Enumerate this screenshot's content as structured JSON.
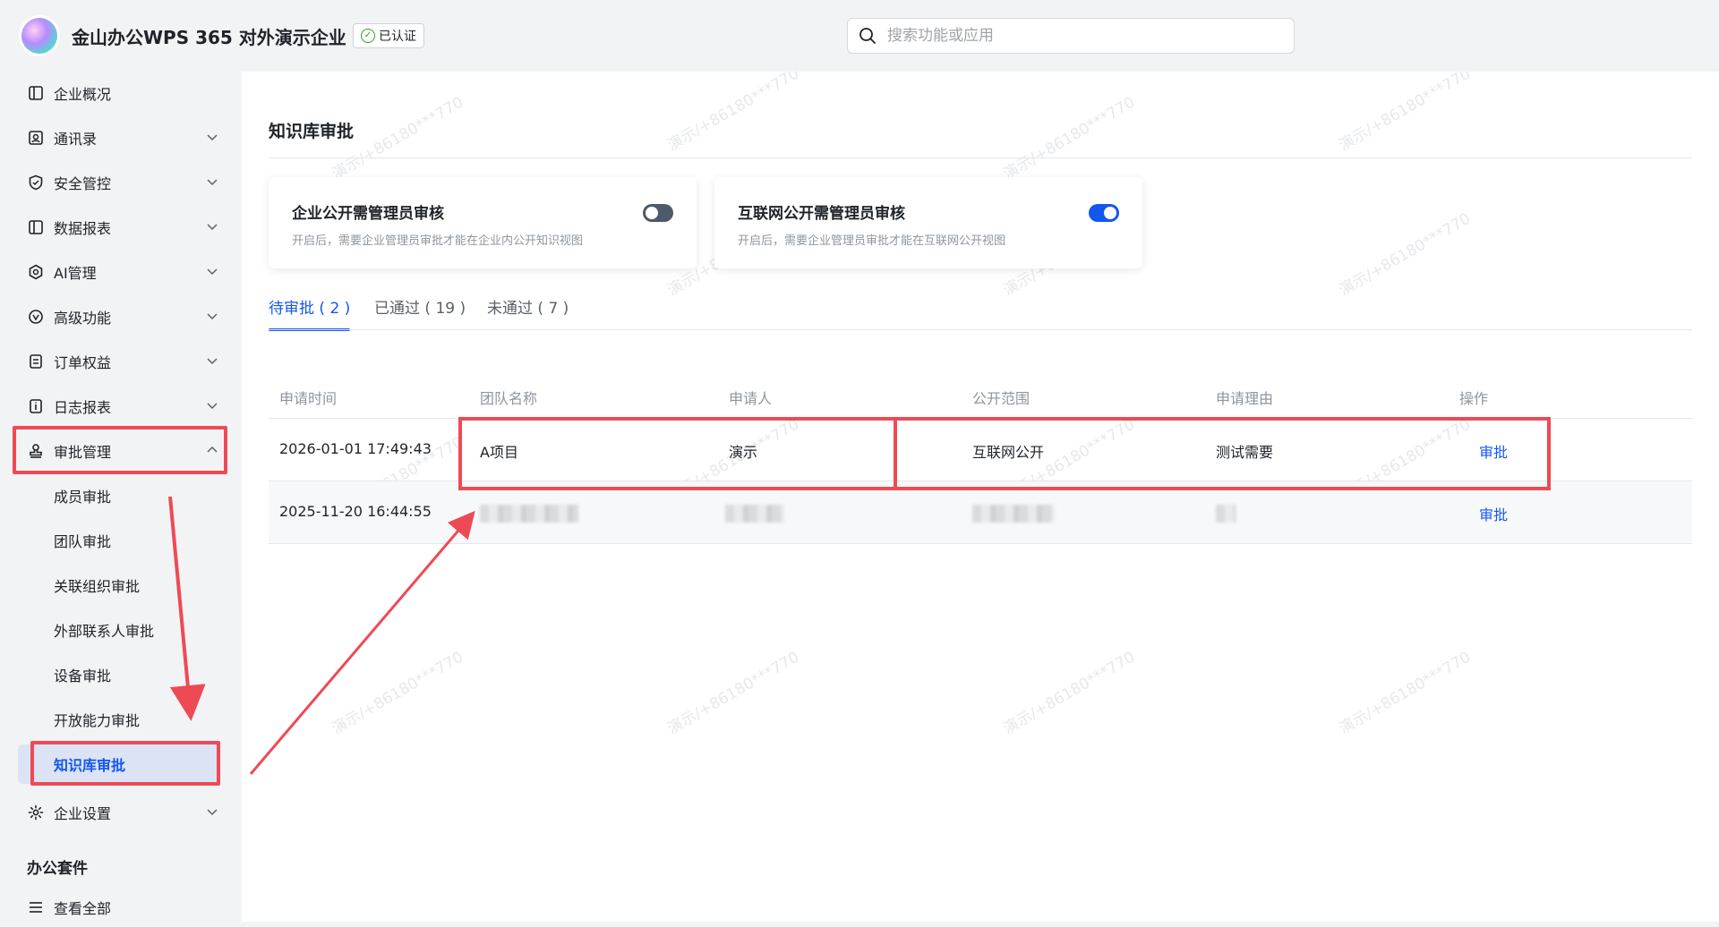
{
  "header": {
    "org_name": "金山办公WPS 365 对外演示企业",
    "verified_label": "已认证",
    "search_placeholder": "搜索功能或应用"
  },
  "sidebar": {
    "items": [
      {
        "label": "企业概况",
        "icon": "book-icon",
        "chevron": false
      },
      {
        "label": "通讯录",
        "icon": "contacts-icon",
        "chevron": true
      },
      {
        "label": "安全管控",
        "icon": "shield-icon",
        "chevron": true
      },
      {
        "label": "数据报表",
        "icon": "report-icon",
        "chevron": true
      },
      {
        "label": "AI管理",
        "icon": "ai-icon",
        "chevron": true
      },
      {
        "label": "高级功能",
        "icon": "advanced-icon",
        "chevron": true
      },
      {
        "label": "订单权益",
        "icon": "order-icon",
        "chevron": true
      },
      {
        "label": "日志报表",
        "icon": "log-icon",
        "chevron": true
      },
      {
        "label": "审批管理",
        "icon": "stamp-icon",
        "chevron": true,
        "expanded": true
      }
    ],
    "sub_items": [
      "成员审批",
      "团队审批",
      "关联组织审批",
      "外部联系人审批",
      "设备审批",
      "开放能力审批",
      "知识库审批"
    ],
    "active_sub": "知识库审批",
    "settings_label": "企业设置",
    "section_label": "办公套件",
    "view_all_label": "查看全部"
  },
  "main": {
    "page_title": "知识库审批",
    "cards": [
      {
        "title": "企业公开需管理员审核",
        "desc": "开启后，需要企业管理员审批才能在企业内公开知识视图",
        "enabled": false
      },
      {
        "title": "互联网公开需管理员审核",
        "desc": "开启后，需要企业管理员审批才能在互联网公开视图",
        "enabled": true
      }
    ],
    "tabs": [
      {
        "label": "待审批 ( 2 )",
        "active": true
      },
      {
        "label": "已通过 ( 19 )",
        "active": false
      },
      {
        "label": "未通过 ( 7 )",
        "active": false
      }
    ],
    "columns": [
      "申请时间",
      "团队名称",
      "申请人",
      "公开范围",
      "申请理由",
      "操作"
    ],
    "rows": [
      {
        "time": "2026-01-01 17:49:43",
        "team": "A项目",
        "applicant": "演示",
        "scope": "互联网公开",
        "reason": "测试需要",
        "action": "审批"
      },
      {
        "time": "2025-11-20 16:44:55",
        "team": "",
        "applicant": "",
        "scope": "",
        "reason": "",
        "action": "审批"
      }
    ]
  },
  "watermark_text": "演示/+86180***770",
  "colors": {
    "accent": "#1456f0",
    "highlight_red": "#ee4a55",
    "verified_green": "#2ea121"
  }
}
